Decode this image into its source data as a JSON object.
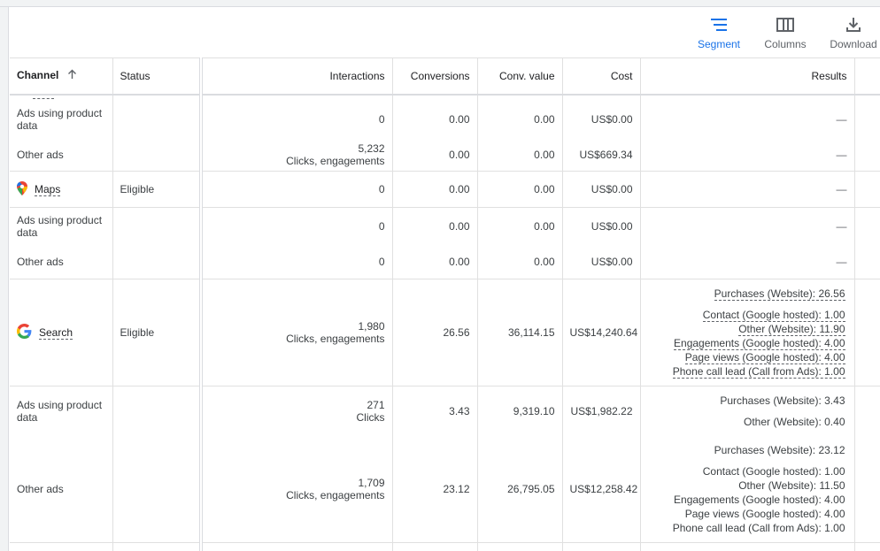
{
  "toolbar": {
    "segment_label": "Segment",
    "columns_label": "Columns",
    "download_label": "Download"
  },
  "table": {
    "headers": {
      "channel": "Channel",
      "status": "Status",
      "interactions": "Interactions",
      "conversions": "Conversions",
      "conv_value": "Conv. value",
      "cost": "Cost",
      "results": "Results"
    },
    "sort_icon": "arrow-up-icon",
    "rows": {
      "top_ads_product": {
        "channel": "Ads using product data",
        "interactions": "0",
        "conversions": "0.00",
        "conv_value": "0.00",
        "cost": "US$0.00",
        "results": "—"
      },
      "top_other_ads": {
        "channel": "Other ads",
        "interactions": "5,232",
        "interactions_sub": "Clicks, engagements",
        "conversions": "0.00",
        "conv_value": "0.00",
        "cost": "US$669.34",
        "results": "—"
      },
      "maps": {
        "channel": "Maps",
        "icon": "maps-pin-icon",
        "status": "Eligible",
        "interactions": "0",
        "conversions": "0.00",
        "conv_value": "0.00",
        "cost": "US$0.00",
        "results": "—"
      },
      "maps_ads_product": {
        "channel": "Ads using product data",
        "interactions": "0",
        "conversions": "0.00",
        "conv_value": "0.00",
        "cost": "US$0.00",
        "results": "—"
      },
      "maps_other_ads": {
        "channel": "Other ads",
        "interactions": "0",
        "conversions": "0.00",
        "conv_value": "0.00",
        "cost": "US$0.00",
        "results": "—"
      },
      "search": {
        "channel": "Search",
        "icon": "google-g-icon",
        "status": "Eligible",
        "interactions": "1,980",
        "interactions_sub": "Clicks, engagements",
        "conversions": "26.56",
        "conv_value": "36,114.15",
        "cost": "US$14,240.64",
        "results_main": "Purchases (Website): 26.56",
        "results": [
          "Contact (Google hosted): 1.00",
          "Other (Website): 11.90",
          "Engagements (Google hosted): 4.00",
          "Page views (Google hosted): 4.00",
          "Phone call lead (Call from Ads): 1.00"
        ]
      },
      "search_ads_product": {
        "channel": "Ads using product data",
        "interactions": "271",
        "interactions_sub": "Clicks",
        "conversions": "3.43",
        "conv_value": "9,319.10",
        "cost": "US$1,982.22",
        "results_main": "Purchases (Website): 3.43",
        "results": [
          "Other (Website): 0.40"
        ]
      },
      "search_other_ads": {
        "channel": "Other ads",
        "interactions": "1,709",
        "interactions_sub": "Clicks, engagements",
        "conversions": "23.12",
        "conv_value": "26,795.05",
        "cost": "US$12,258.42",
        "results_main": "Purchases (Website): 23.12",
        "results": [
          "Contact (Google hosted): 1.00",
          "Other (Website): 11.50",
          "Engagements (Google hosted): 4.00",
          "Page views (Google hosted): 4.00",
          "Phone call lead (Call from Ads): 1.00"
        ]
      }
    }
  }
}
